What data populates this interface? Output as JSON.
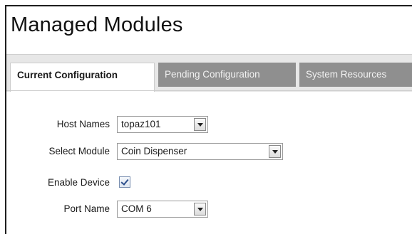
{
  "page": {
    "title": "Managed Modules"
  },
  "tabs": [
    {
      "label": "Current Configuration",
      "active": true
    },
    {
      "label": "Pending Configuration",
      "active": false
    },
    {
      "label": "System Resources",
      "active": false
    }
  ],
  "form": {
    "host_names": {
      "label": "Host Names",
      "value": "topaz101"
    },
    "select_module": {
      "label": "Select Module",
      "value": "Coin Dispenser"
    },
    "enable_device": {
      "label": "Enable Device",
      "checked": true
    },
    "port_name": {
      "label": "Port Name",
      "value": "COM 6"
    }
  },
  "icons": {
    "dropdown": "chevron-down-icon",
    "checkbox": "checkmark-icon"
  },
  "colors": {
    "tab_inactive_bg": "#8f8f8f",
    "tab_bar_bg": "#e7e7e7",
    "checkbox_check": "#2c4f8c"
  }
}
